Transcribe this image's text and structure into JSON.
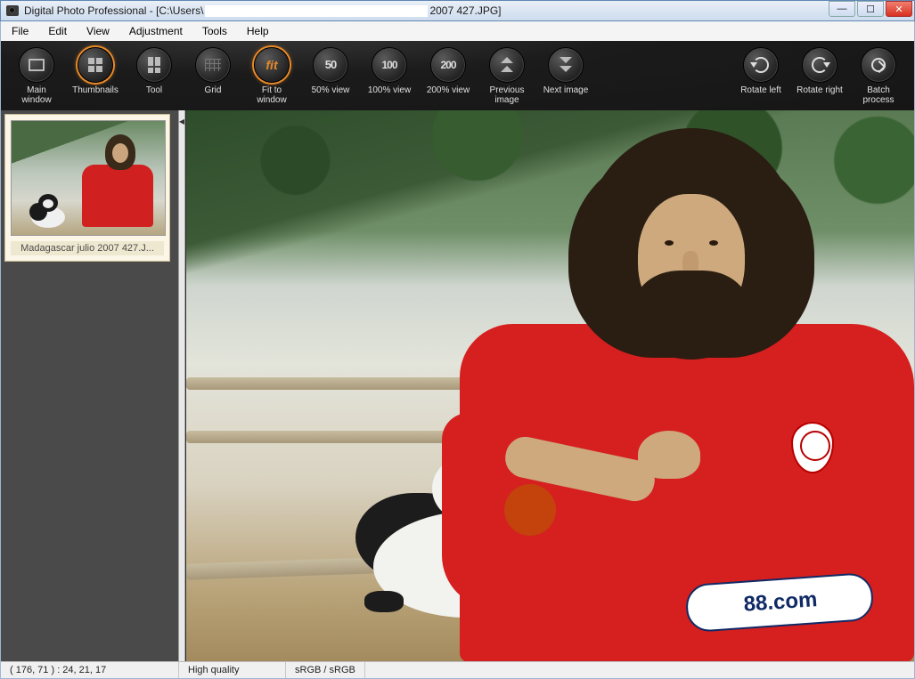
{
  "title": {
    "app": "Digital Photo Professional",
    "path_prefix": " - [C:\\Users\\",
    "path_suffix": "2007 427.JPG]"
  },
  "menu": [
    "File",
    "Edit",
    "View",
    "Adjustment",
    "Tools",
    "Help"
  ],
  "toolbar": {
    "main_window": "Main window",
    "thumbnails": "Thumbnails",
    "tool": "Tool",
    "grid": "Grid",
    "fit": "Fit to window",
    "view50": "50% view",
    "view50_icon": "50",
    "view100": "100% view",
    "view100_icon": "100",
    "view200": "200% view",
    "view200_icon": "200",
    "prev": "Previous image",
    "next": "Next image",
    "rotate_left": "Rotate left",
    "rotate_right": "Rotate right",
    "batch": "Batch process"
  },
  "thumbnail": {
    "caption": "Madagascar julio 2007 427.J..."
  },
  "sponsor_text": "88.com",
  "status": {
    "coords": "( 176, 71 ) :  24, 21, 17",
    "quality": "High quality",
    "colorspace": "sRGB / sRGB"
  }
}
